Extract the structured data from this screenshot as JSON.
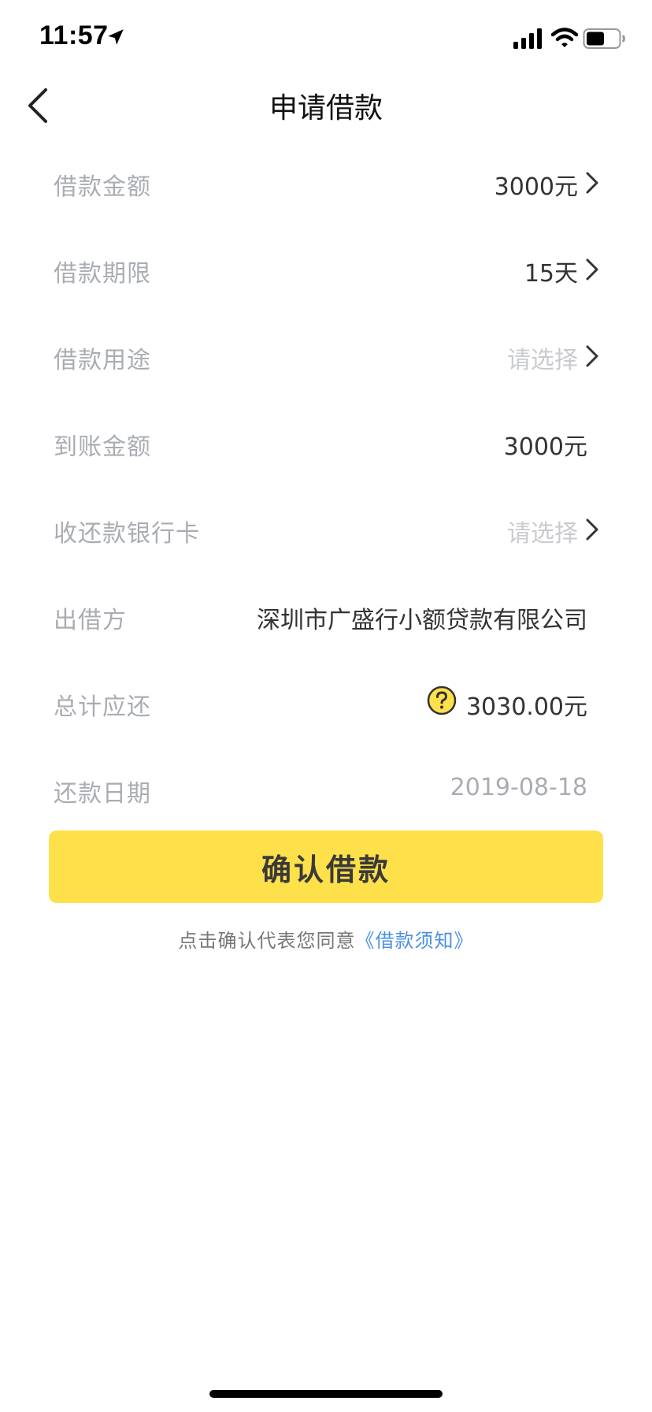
{
  "status_bar": {
    "time": "11:57"
  },
  "nav": {
    "title": "申请借款"
  },
  "form": {
    "rows": [
      {
        "label": "借款金额",
        "value": "3000元"
      },
      {
        "label": "借款期限",
        "value": "15天"
      },
      {
        "label": "借款用途",
        "value": "请选择"
      },
      {
        "label": "到账金额",
        "value": "3000元"
      },
      {
        "label": "收还款银行卡",
        "value": "请选择"
      },
      {
        "label": "出借方",
        "value": "深圳市广盛行小额贷款有限公司"
      },
      {
        "label": "总计应还",
        "value": "3030.00元"
      },
      {
        "label": "还款日期",
        "value": "2019-08-18"
      }
    ]
  },
  "confirm_button": {
    "label": "确认借款"
  },
  "agreement": {
    "prefix": "点击确认代表您同意",
    "link": "《借款须知》"
  },
  "colors": {
    "accent": "#fee14a",
    "link": "#4a90e2",
    "label": "#a9adb3",
    "placeholder": "#c9cbcf"
  }
}
